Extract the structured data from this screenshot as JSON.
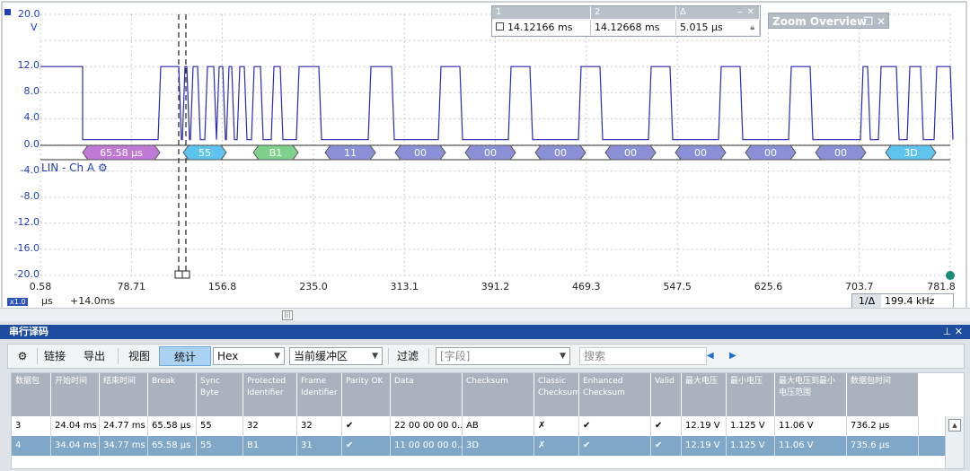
{
  "scope": {
    "y_unit_value": "20.0",
    "y_unit": "V",
    "y_ticks": [
      "12.0",
      "8.0",
      "4.0",
      "0.0",
      "-4.0",
      "-8.0",
      "-12.0",
      "-16.0",
      "-20.0"
    ],
    "x_ticks": [
      "0.58",
      "78.71",
      "156.8",
      "235.0",
      "313.1",
      "391.2",
      "469.3",
      "547.5",
      "625.6",
      "703.7",
      "781.8"
    ],
    "x_unit": "µs",
    "x_offset": "+14.0ms",
    "zoom_badge": "x1.0",
    "channel_label": "LIN - Ch A",
    "trace_color": "#2a2ab8",
    "decode_bytes": [
      {
        "text": "65.58 µs",
        "color": "#c07ad6"
      },
      {
        "text": "55",
        "color": "#5ec4ee"
      },
      {
        "text": "B1",
        "color": "#7fd08a"
      },
      {
        "text": "11",
        "color": "#8a8fd6"
      },
      {
        "text": "00",
        "color": "#8a8fd6"
      },
      {
        "text": "00",
        "color": "#8a8fd6"
      },
      {
        "text": "00",
        "color": "#8a8fd6"
      },
      {
        "text": "00",
        "color": "#8a8fd6"
      },
      {
        "text": "00",
        "color": "#8a8fd6"
      },
      {
        "text": "00",
        "color": "#8a8fd6"
      },
      {
        "text": "00",
        "color": "#8a8fd6"
      },
      {
        "text": "3D",
        "color": "#5ec4ee"
      }
    ]
  },
  "cursors": {
    "headers": [
      "1",
      "2",
      "Δ"
    ],
    "values": [
      "14.12166 ms",
      "14.12668 ms",
      "5.015 µs"
    ]
  },
  "zoom_overview": {
    "title": "Zoom Overview"
  },
  "frequency": {
    "label": "1/Δ",
    "value": "199.4 kHz"
  },
  "panel": {
    "title": "串行译码"
  },
  "toolbar": {
    "link": "链接",
    "export": "导出",
    "view": "视图",
    "stats": "统计",
    "format": "Hex",
    "buffer": "当前缓冲区",
    "filter": "过滤",
    "field_placeholder": "[字段]",
    "search_placeholder": "搜索"
  },
  "table": {
    "headers": [
      "数据包",
      "开始时间",
      "结束时间",
      "Break",
      "Sync Byte",
      "Protected Identifier",
      "Frame Identifier",
      "Parity OK",
      "Data",
      "Checksum",
      "Classic Checksum",
      "Enhanced Checksum",
      "Valid",
      "最大电压",
      "最小电压",
      "最大电压到最小电压范围",
      "数据包时间"
    ],
    "rows": [
      [
        "3",
        "24.04 ms",
        "24.77 ms",
        "65.58 µs",
        "55",
        "32",
        "32",
        "✔",
        "22 00 00 00 0...",
        "AB",
        "✗",
        "✔",
        "✔",
        "12.19 V",
        "1.125 V",
        "11.06 V",
        "736.2 µs"
      ],
      [
        "4",
        "34.04 ms",
        "34.77 ms",
        "65.58 µs",
        "55",
        "B1",
        "31",
        "✔",
        "11 00 00 00 0...",
        "3D",
        "✗",
        "✔",
        "✔",
        "12.19 V",
        "1.125 V",
        "11.06 V",
        "735.6 µs"
      ]
    ]
  }
}
